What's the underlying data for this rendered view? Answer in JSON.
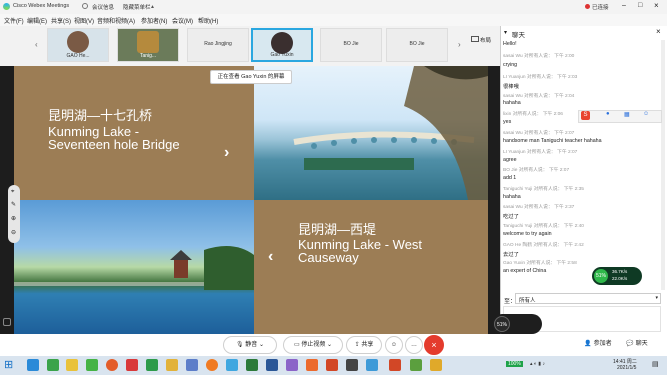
{
  "window": {
    "title": "Cisco Webex Meetings",
    "info": "会议信息",
    "hide": "隐藏菜单栏",
    "connected": "已连接"
  },
  "menu": [
    "文件(F)",
    "编辑(E)",
    "共享(S)",
    "视图(V)",
    "音频和视频(A)",
    "参加者(N)",
    "会议(M)",
    "帮助(H)"
  ],
  "participants": [
    {
      "name": "GAO He..."
    },
    {
      "name": "Tanig..."
    },
    {
      "name": "Rao Jingjing"
    },
    {
      "name": "Gao Yuxin"
    },
    {
      "name": "BO Jie"
    },
    {
      "name": "BO Jie"
    }
  ],
  "layout_label": "布局",
  "share_banner": "正在查看 Gao Yuxin 的屏幕",
  "slides": {
    "a_cn": "昆明湖—十七孔桥",
    "a_en1": "Kunming Lake -",
    "a_en2": "Seventeen hole Bridge",
    "b_cn": "昆明湖—西堤",
    "b_en1": "Kunming Lake - West",
    "b_en2": "Causeway"
  },
  "chat_panel": {
    "title": "聊天"
  },
  "chat": [
    {
      "text": "Hello!",
      "meta": "Gao Yuxin 对所有人说：  下午 2:58"
    },
    {
      "text": "crying",
      "meta": "sasai Wu 对所有人说：  下午 2:00"
    },
    {
      "text": "很棒哦",
      "meta": "LI Yuanjun 对所有人说：  下午 2:03"
    },
    {
      "text": "hahaha",
      "meta": "sasai Wu 对所有人说：  下午 2:04"
    },
    {
      "text": "yes",
      "meta": "lixin 对所有人说：  下午 2:06"
    },
    {
      "text": "handsome man Taniguchi teacher hahaha",
      "meta": "sasai Wu 对所有人说：  下午 2:07"
    },
    {
      "text": "agree",
      "meta": "LI Yuanjun 对所有人说：  下午 2:07"
    },
    {
      "text": "add 1",
      "meta": "BO Jie 对所有人说：  下午 2:07"
    },
    {
      "text": "hahaha",
      "meta": "Taniguchi Yuji 对所有人说：  下午 2:35"
    },
    {
      "text": "吃过了",
      "meta": "sasai Wu 对所有人说：  下午 2:37"
    },
    {
      "text": "welcome to try again",
      "meta": "Taniguchi Yuji 对所有人说：  下午 2:40"
    },
    {
      "text": "去过了",
      "meta": "GAO He 陶鹤 对所有人说：  下午 2:42"
    },
    {
      "text": "an expert of China",
      "meta": ""
    }
  ],
  "chat_to_label": "至：",
  "chat_to_value": "所有人",
  "net": {
    "percent": "51%",
    "up": "36.7K/s",
    "down": "22.0K/s"
  },
  "controls": {
    "mute": "静音",
    "stop_video": "停止视频",
    "share": "共享",
    "participants": "参加者",
    "chat": "聊天"
  },
  "speaker_badge": "51%",
  "taskbar": {
    "time": "14:41 周二",
    "date": "2021/1/5",
    "zoom": "100%"
  },
  "colors": {
    "accent": "#1a73c7",
    "slide_brown": "#9c7d55",
    "end_red": "#e43b2d"
  }
}
